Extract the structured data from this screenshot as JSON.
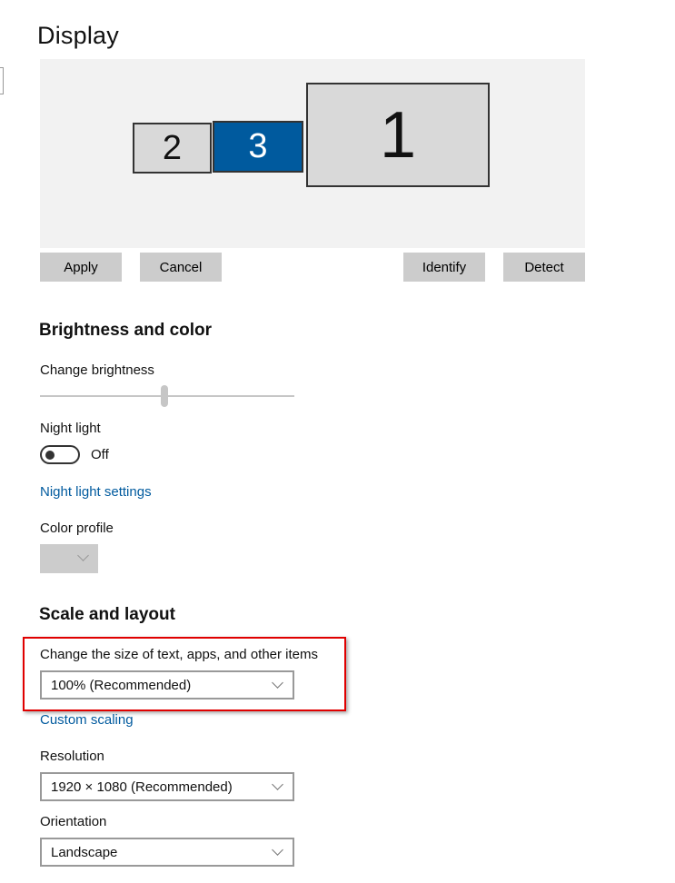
{
  "page": {
    "title": "Display"
  },
  "monitors": [
    {
      "id": "2",
      "label": "2",
      "selected": false
    },
    {
      "id": "3",
      "label": "3",
      "selected": true
    },
    {
      "id": "1",
      "label": "1",
      "selected": false
    }
  ],
  "buttons": {
    "apply": "Apply",
    "cancel": "Cancel",
    "identify": "Identify",
    "detect": "Detect"
  },
  "brightness_color": {
    "title": "Brightness and color",
    "brightness_label": "Change brightness",
    "brightness_value_percent": 49,
    "night_light_label": "Night light",
    "night_light_state": "Off",
    "night_light_on": false,
    "night_light_settings_link": "Night light settings",
    "color_profile_label": "Color profile",
    "color_profile_value": ""
  },
  "scale_layout": {
    "title": "Scale and layout",
    "size_label": "Change the size of text, apps, and other items",
    "size_value": "100% (Recommended)",
    "custom_scaling_link": "Custom scaling",
    "resolution_label": "Resolution",
    "resolution_value": "1920 × 1080 (Recommended)",
    "orientation_label": "Orientation",
    "orientation_value": "Landscape"
  },
  "colors": {
    "accent": "#005a9e",
    "highlight_border": "#e00000",
    "button_bg": "#cccccc",
    "monitor_area_bg": "#f2f2f2"
  }
}
